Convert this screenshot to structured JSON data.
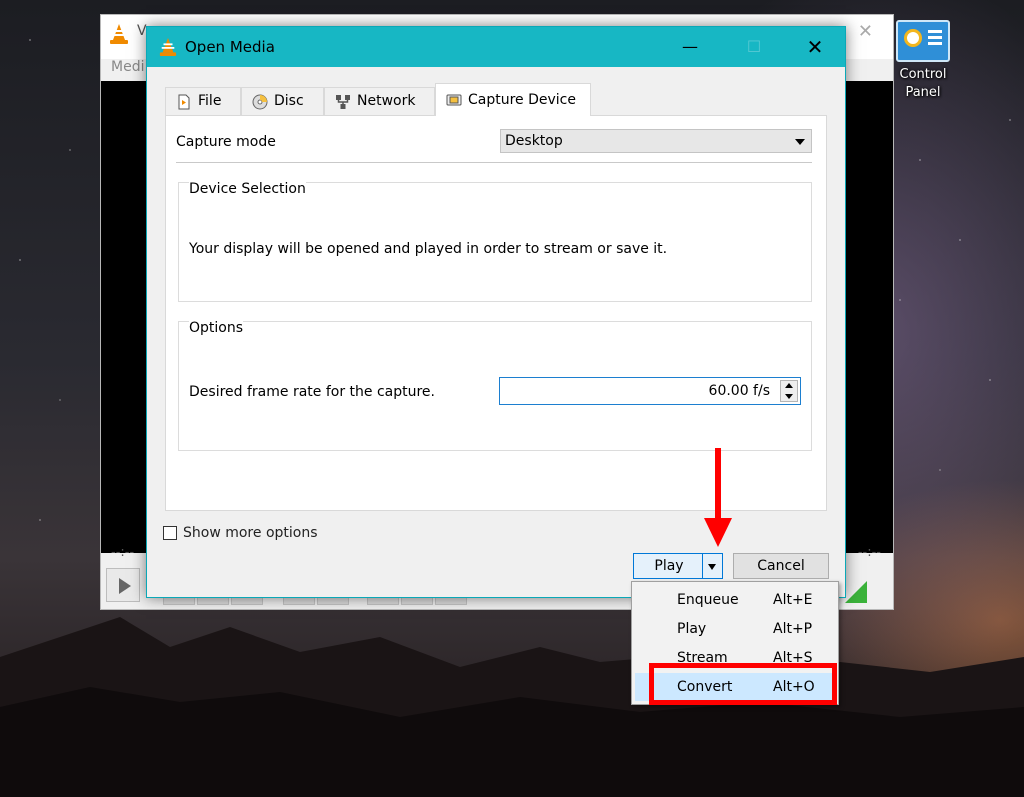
{
  "desktop": {
    "icon_label": "Control\nPanel"
  },
  "vlc_back": {
    "title": "V",
    "menu": "Medi",
    "time_left": "--:--",
    "time_right": "--:--"
  },
  "dialog": {
    "title": "Open Media",
    "tabs": [
      {
        "label": "File",
        "icon": "file-icon"
      },
      {
        "label": "Disc",
        "icon": "disc-icon"
      },
      {
        "label": "Network",
        "icon": "network-icon"
      },
      {
        "label": "Capture Device",
        "icon": "capture-device-icon"
      }
    ],
    "active_tab": "Capture Device",
    "capture_mode": {
      "label": "Capture mode",
      "value": "Desktop"
    },
    "device_selection": {
      "title": "Device Selection",
      "message": "Your display will be opened and played in order to stream or save it."
    },
    "options": {
      "title": "Options",
      "frame_rate_label": "Desired frame rate for the capture.",
      "frame_rate_value": "60.00 f/s"
    },
    "show_more_options": {
      "label": "Show more options",
      "checked": false
    },
    "play_button": "Play",
    "cancel_button": "Cancel"
  },
  "play_menu": {
    "items": [
      {
        "label": "Enqueue",
        "shortcut": "Alt+E"
      },
      {
        "label": "Play",
        "shortcut": "Alt+P"
      },
      {
        "label": "Stream",
        "shortcut": "Alt+S"
      },
      {
        "label": "Convert",
        "shortcut": "Alt+O",
        "highlighted": true
      }
    ]
  },
  "colors": {
    "title_bar": "#17b7c4",
    "annotation_red": "#ff0000",
    "menu_highlight": "#cce8ff",
    "vlc_orange": "#f08a00"
  }
}
